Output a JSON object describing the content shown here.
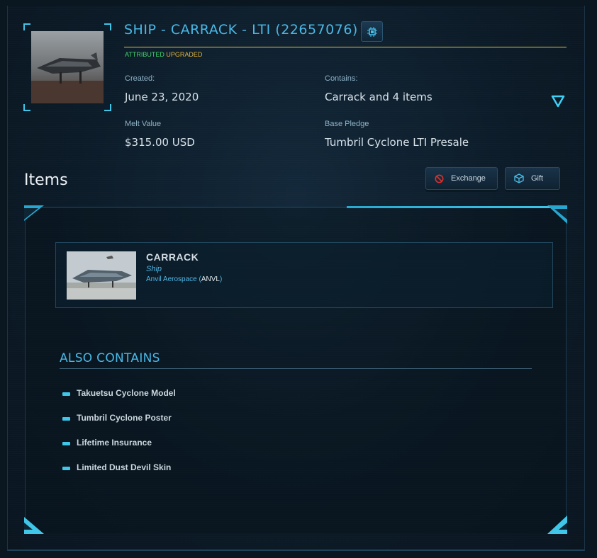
{
  "header": {
    "title": "SHIP - CARRACK - LTI (22657076)",
    "tag_attributed": "ATTRIBUTED",
    "tag_upgraded": "UPGRADED",
    "chip_icon": "chip-icon",
    "fields": {
      "created_label": "Created:",
      "created_value": "June 23, 2020",
      "contains_label": "Contains:",
      "contains_value": "Carrack and 4 items",
      "melt_label": "Melt Value",
      "melt_value": "$315.00 USD",
      "base_label": "Base Pledge",
      "base_value": "Tumbril Cyclone LTI Presale"
    }
  },
  "items_section": {
    "title": "Items",
    "exchange_label": "Exchange",
    "gift_label": "Gift"
  },
  "ship": {
    "name": "CARRACK",
    "type": "Ship",
    "manufacturer": "Anvil Aerospace",
    "manufacturer_code": "ANVL",
    "paren_open": " (",
    "paren_close": ")"
  },
  "also_contains": {
    "title": "ALSO CONTAINS",
    "items": [
      "Takuetsu Cyclone Model",
      "Tumbril Cyclone Poster",
      "Lifetime Insurance",
      "Limited Dust Devil Skin"
    ]
  },
  "colors": {
    "accent": "#49b8e6",
    "attributed": "#3fd36a",
    "upgraded": "#e0b33c",
    "title_rule": "#d9c44a"
  }
}
